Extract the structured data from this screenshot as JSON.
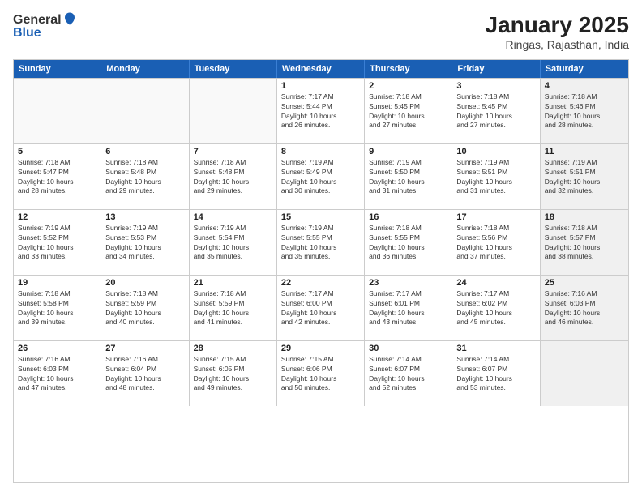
{
  "logo": {
    "general": "General",
    "blue": "Blue"
  },
  "title": "January 2025",
  "subtitle": "Ringas, Rajasthan, India",
  "days": [
    "Sunday",
    "Monday",
    "Tuesday",
    "Wednesday",
    "Thursday",
    "Friday",
    "Saturday"
  ],
  "rows": [
    [
      {
        "day": "",
        "lines": [],
        "empty": true
      },
      {
        "day": "",
        "lines": [],
        "empty": true
      },
      {
        "day": "",
        "lines": [],
        "empty": true
      },
      {
        "day": "1",
        "lines": [
          "Sunrise: 7:17 AM",
          "Sunset: 5:44 PM",
          "Daylight: 10 hours",
          "and 26 minutes."
        ]
      },
      {
        "day": "2",
        "lines": [
          "Sunrise: 7:18 AM",
          "Sunset: 5:45 PM",
          "Daylight: 10 hours",
          "and 27 minutes."
        ]
      },
      {
        "day": "3",
        "lines": [
          "Sunrise: 7:18 AM",
          "Sunset: 5:45 PM",
          "Daylight: 10 hours",
          "and 27 minutes."
        ]
      },
      {
        "day": "4",
        "lines": [
          "Sunrise: 7:18 AM",
          "Sunset: 5:46 PM",
          "Daylight: 10 hours",
          "and 28 minutes."
        ],
        "shaded": true
      }
    ],
    [
      {
        "day": "5",
        "lines": [
          "Sunrise: 7:18 AM",
          "Sunset: 5:47 PM",
          "Daylight: 10 hours",
          "and 28 minutes."
        ]
      },
      {
        "day": "6",
        "lines": [
          "Sunrise: 7:18 AM",
          "Sunset: 5:48 PM",
          "Daylight: 10 hours",
          "and 29 minutes."
        ]
      },
      {
        "day": "7",
        "lines": [
          "Sunrise: 7:18 AM",
          "Sunset: 5:48 PM",
          "Daylight: 10 hours",
          "and 29 minutes."
        ]
      },
      {
        "day": "8",
        "lines": [
          "Sunrise: 7:19 AM",
          "Sunset: 5:49 PM",
          "Daylight: 10 hours",
          "and 30 minutes."
        ]
      },
      {
        "day": "9",
        "lines": [
          "Sunrise: 7:19 AM",
          "Sunset: 5:50 PM",
          "Daylight: 10 hours",
          "and 31 minutes."
        ]
      },
      {
        "day": "10",
        "lines": [
          "Sunrise: 7:19 AM",
          "Sunset: 5:51 PM",
          "Daylight: 10 hours",
          "and 31 minutes."
        ]
      },
      {
        "day": "11",
        "lines": [
          "Sunrise: 7:19 AM",
          "Sunset: 5:51 PM",
          "Daylight: 10 hours",
          "and 32 minutes."
        ],
        "shaded": true
      }
    ],
    [
      {
        "day": "12",
        "lines": [
          "Sunrise: 7:19 AM",
          "Sunset: 5:52 PM",
          "Daylight: 10 hours",
          "and 33 minutes."
        ]
      },
      {
        "day": "13",
        "lines": [
          "Sunrise: 7:19 AM",
          "Sunset: 5:53 PM",
          "Daylight: 10 hours",
          "and 34 minutes."
        ]
      },
      {
        "day": "14",
        "lines": [
          "Sunrise: 7:19 AM",
          "Sunset: 5:54 PM",
          "Daylight: 10 hours",
          "and 35 minutes."
        ]
      },
      {
        "day": "15",
        "lines": [
          "Sunrise: 7:19 AM",
          "Sunset: 5:55 PM",
          "Daylight: 10 hours",
          "and 35 minutes."
        ]
      },
      {
        "day": "16",
        "lines": [
          "Sunrise: 7:18 AM",
          "Sunset: 5:55 PM",
          "Daylight: 10 hours",
          "and 36 minutes."
        ]
      },
      {
        "day": "17",
        "lines": [
          "Sunrise: 7:18 AM",
          "Sunset: 5:56 PM",
          "Daylight: 10 hours",
          "and 37 minutes."
        ]
      },
      {
        "day": "18",
        "lines": [
          "Sunrise: 7:18 AM",
          "Sunset: 5:57 PM",
          "Daylight: 10 hours",
          "and 38 minutes."
        ],
        "shaded": true
      }
    ],
    [
      {
        "day": "19",
        "lines": [
          "Sunrise: 7:18 AM",
          "Sunset: 5:58 PM",
          "Daylight: 10 hours",
          "and 39 minutes."
        ]
      },
      {
        "day": "20",
        "lines": [
          "Sunrise: 7:18 AM",
          "Sunset: 5:59 PM",
          "Daylight: 10 hours",
          "and 40 minutes."
        ]
      },
      {
        "day": "21",
        "lines": [
          "Sunrise: 7:18 AM",
          "Sunset: 5:59 PM",
          "Daylight: 10 hours",
          "and 41 minutes."
        ]
      },
      {
        "day": "22",
        "lines": [
          "Sunrise: 7:17 AM",
          "Sunset: 6:00 PM",
          "Daylight: 10 hours",
          "and 42 minutes."
        ]
      },
      {
        "day": "23",
        "lines": [
          "Sunrise: 7:17 AM",
          "Sunset: 6:01 PM",
          "Daylight: 10 hours",
          "and 43 minutes."
        ]
      },
      {
        "day": "24",
        "lines": [
          "Sunrise: 7:17 AM",
          "Sunset: 6:02 PM",
          "Daylight: 10 hours",
          "and 45 minutes."
        ]
      },
      {
        "day": "25",
        "lines": [
          "Sunrise: 7:16 AM",
          "Sunset: 6:03 PM",
          "Daylight: 10 hours",
          "and 46 minutes."
        ],
        "shaded": true
      }
    ],
    [
      {
        "day": "26",
        "lines": [
          "Sunrise: 7:16 AM",
          "Sunset: 6:03 PM",
          "Daylight: 10 hours",
          "and 47 minutes."
        ]
      },
      {
        "day": "27",
        "lines": [
          "Sunrise: 7:16 AM",
          "Sunset: 6:04 PM",
          "Daylight: 10 hours",
          "and 48 minutes."
        ]
      },
      {
        "day": "28",
        "lines": [
          "Sunrise: 7:15 AM",
          "Sunset: 6:05 PM",
          "Daylight: 10 hours",
          "and 49 minutes."
        ]
      },
      {
        "day": "29",
        "lines": [
          "Sunrise: 7:15 AM",
          "Sunset: 6:06 PM",
          "Daylight: 10 hours",
          "and 50 minutes."
        ]
      },
      {
        "day": "30",
        "lines": [
          "Sunrise: 7:14 AM",
          "Sunset: 6:07 PM",
          "Daylight: 10 hours",
          "and 52 minutes."
        ]
      },
      {
        "day": "31",
        "lines": [
          "Sunrise: 7:14 AM",
          "Sunset: 6:07 PM",
          "Daylight: 10 hours",
          "and 53 minutes."
        ]
      },
      {
        "day": "",
        "lines": [],
        "empty": true,
        "shaded": true
      }
    ]
  ]
}
